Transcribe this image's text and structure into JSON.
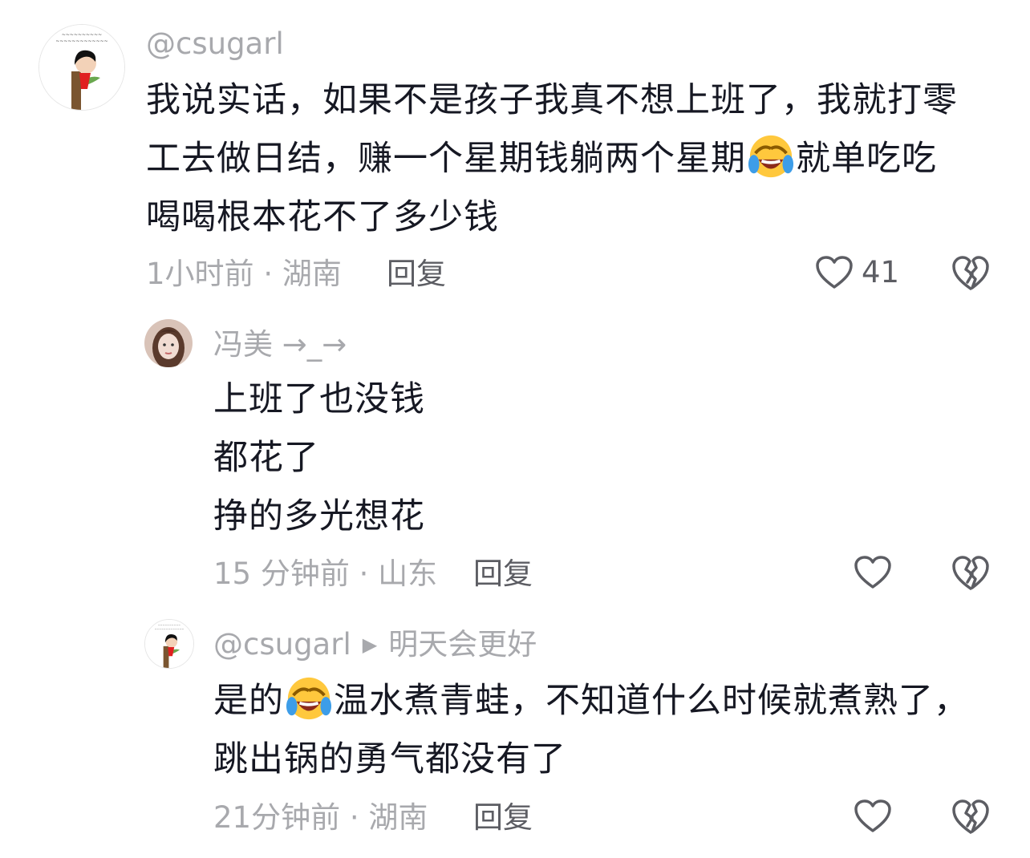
{
  "comments": [
    {
      "username": "@csugarl",
      "lines": [
        "我说实话，如果不是孩子我真不想上班了，我就打零",
        "工去做日结，赚一个星期钱躺两个星期",
        "就单吃吃",
        "喝喝根本花不了多少钱"
      ],
      "time": "1小时前",
      "location": "湖南",
      "sep": "·",
      "reply_label": "回复",
      "likes": "41"
    },
    {
      "username": "冯美 →_→",
      "lines": [
        "上班了也没钱",
        "都花了",
        "挣的多光想花"
      ],
      "time": "15 分钟前",
      "location": "山东",
      "sep": "·",
      "reply_label": "回复"
    },
    {
      "username": "@csugarl",
      "reply_to": "明天会更好",
      "reply_arrow": "▶",
      "lines": [
        "是的",
        "温水煮青蛙，不知道什么时候就煮熟了，",
        "跳出锅的勇气都没有了"
      ],
      "time": "21分钟前",
      "location": "湖南",
      "sep": "·",
      "reply_label": "回复"
    }
  ],
  "icons": {
    "like": "heart-outline-icon",
    "dislike": "broken-heart-icon",
    "emoji": "rolling-laughing-crying-emoji"
  },
  "colors": {
    "text": "#161823",
    "muted": "#a8a9ad",
    "action": "#5c5d63"
  }
}
